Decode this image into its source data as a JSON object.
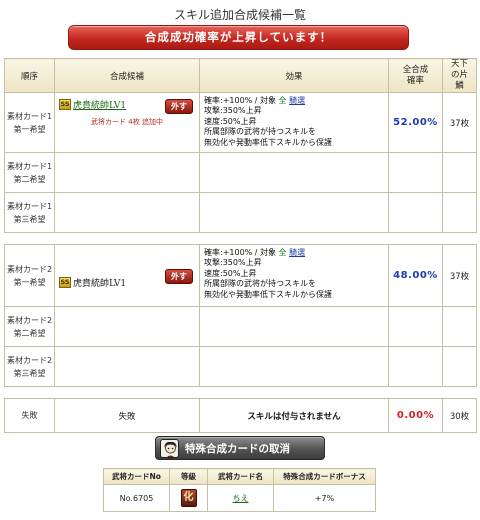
{
  "page": {
    "title": "スキル追加合成候補一覧",
    "banner": "合成成功確率が上昇しています！"
  },
  "table": {
    "headers": {
      "order": "順序",
      "candidate": "合成候補",
      "effect": "効果",
      "rate": "全合成確率",
      "stock": "天下の片鱗"
    },
    "rows": [
      {
        "label1": "素材カード1",
        "label2": "第一希望",
        "skill": "虎賁統帥LV1",
        "badge": "SS",
        "remove": "外す",
        "note": "武将カード 4枚 追加中",
        "effect": {
          "line1a": "確率:+100% / 対象 ",
          "target": "全",
          "link": "騎選",
          "line2": "攻撃:350%上昇",
          "line3": "速度:50%上昇",
          "line4": "所属部隊の武将が持つスキルを",
          "line5": "無効化や発動率低下スキルから保護"
        },
        "rate": "52.00%",
        "stock": "37枚"
      },
      {
        "label1": "素材カード1",
        "label2": "第二希望"
      },
      {
        "label1": "素材カード1",
        "label2": "第三希望"
      },
      {
        "label1": "素材カード2",
        "label2": "第一希望",
        "skill": "虎賁統帥LV1",
        "badge": "SS",
        "remove": "外す",
        "effect": {
          "line1a": "確率:+100% / 対象 ",
          "target": "全",
          "link": "騎選",
          "line2": "攻撃:350%上昇",
          "line3": "速度:50%上昇",
          "line4": "所属部隊の武将が持つスキルを",
          "line5": "無効化や発動率低下スキルから保護"
        },
        "rate": "48.00%",
        "stock": "37枚"
      },
      {
        "label1": "素材カード2",
        "label2": "第二希望"
      },
      {
        "label1": "素材カード2",
        "label2": "第三希望"
      }
    ],
    "failure": {
      "label": "失敗",
      "candidate": "失敗",
      "effect": "スキルは付与されません",
      "rate": "0.00%",
      "stock": "30枚"
    }
  },
  "cancel_button": {
    "label": "特殊合成カードの取消",
    "icon": "card-portrait-icon"
  },
  "bonus": {
    "headers": [
      "武将カードNo",
      "等級",
      "武将カード名",
      "特殊合成カードボーナス"
    ],
    "row": {
      "card_no": "No.6705",
      "grade": "化",
      "name": "ちえ",
      "bonus": "+7%"
    }
  },
  "colors": {
    "banner": "#c4281f",
    "rate": "#1d3ab5",
    "fail_rate": "#d62020",
    "link": "#1a6a1a"
  }
}
